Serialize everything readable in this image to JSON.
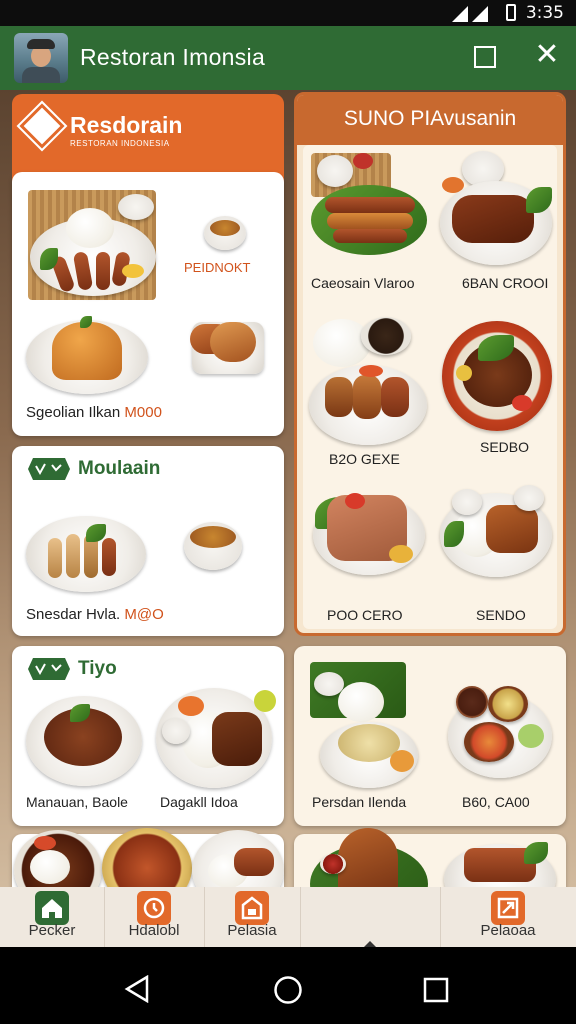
{
  "status_bar": {
    "time": "3:35"
  },
  "app_bar": {
    "title": "Restoran Imonsia"
  },
  "restaurant_card": {
    "title": "Resdorain",
    "subtitle": "RESTORAN INDONESIA"
  },
  "right_panel": {
    "title": "SUNO PIAvusanin",
    "items": [
      {
        "label": "Caeosain Vlaroo"
      },
      {
        "label": "6BAN CROOI"
      },
      {
        "label": "B2O GEXE"
      },
      {
        "label": "SEDBO"
      },
      {
        "label": "POO CERO"
      },
      {
        "label": "SENDO"
      }
    ]
  },
  "card_one": {
    "tag": "PEIDNOKT",
    "caption": "Sgeolian Ilkan",
    "price": "M000"
  },
  "section_mou": {
    "title": "Moulaain",
    "caption": "Snesdar Hvla.",
    "price": "M@O"
  },
  "section_tiyo": {
    "title": "Tiyo",
    "captions": [
      "Manauan, Baole",
      "Dagakll Idoa"
    ]
  },
  "lower_right_card": {
    "captions": [
      "Persdan Ilenda",
      "B60, CA00"
    ]
  },
  "bottom_nav": {
    "items": [
      {
        "label": "Pecker"
      },
      {
        "label": "Hdalobl"
      },
      {
        "label": "Pelasia"
      },
      {
        "label": ""
      },
      {
        "label": "Pelaoaa"
      }
    ]
  },
  "colors": {
    "app_bar": "#2f6b34",
    "accent_orange": "#e2692a",
    "panel_border": "#c8692f",
    "nav_green": "#2f6b34"
  }
}
